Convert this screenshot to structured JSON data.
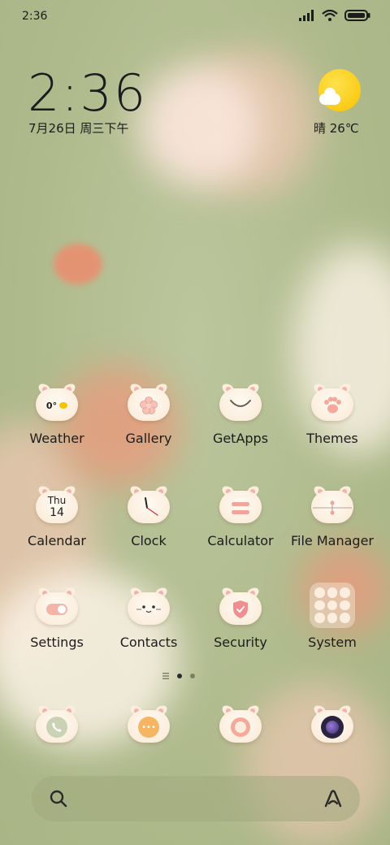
{
  "status_bar": {
    "time": "2:36"
  },
  "clock_widget": {
    "time": "2:36",
    "date": "7月26日 周三下午"
  },
  "weather_widget": {
    "text": "晴 26℃"
  },
  "apps": [
    {
      "label": "Weather",
      "glyph": "0°"
    },
    {
      "label": "Gallery",
      "glyph": "flower"
    },
    {
      "label": "GetApps",
      "glyph": "smile"
    },
    {
      "label": "Themes",
      "glyph": "paw"
    },
    {
      "label": "Calendar",
      "glyph_top": "Thu",
      "glyph_num": "14"
    },
    {
      "label": "Clock",
      "glyph": "clock"
    },
    {
      "label": "Calculator",
      "glyph": "equals"
    },
    {
      "label": "File Manager",
      "glyph": "files"
    },
    {
      "label": "Settings",
      "glyph": "toggle"
    },
    {
      "label": "Contacts",
      "glyph": "cat"
    },
    {
      "label": "Security",
      "glyph": "shield"
    },
    {
      "label": "System",
      "glyph": "folder"
    }
  ],
  "page_indicator": {
    "pages": 2,
    "active": 1
  },
  "dock": [
    {
      "name": "phone",
      "glyph": "phone"
    },
    {
      "name": "messages",
      "glyph": "chat"
    },
    {
      "name": "browser",
      "glyph": "compass"
    },
    {
      "name": "camera",
      "glyph": "lens"
    }
  ],
  "colors": {
    "background": "#b4bf92",
    "blush": "#f4b5a8",
    "peach": "#f3a489",
    "sun": "#f7c300"
  }
}
